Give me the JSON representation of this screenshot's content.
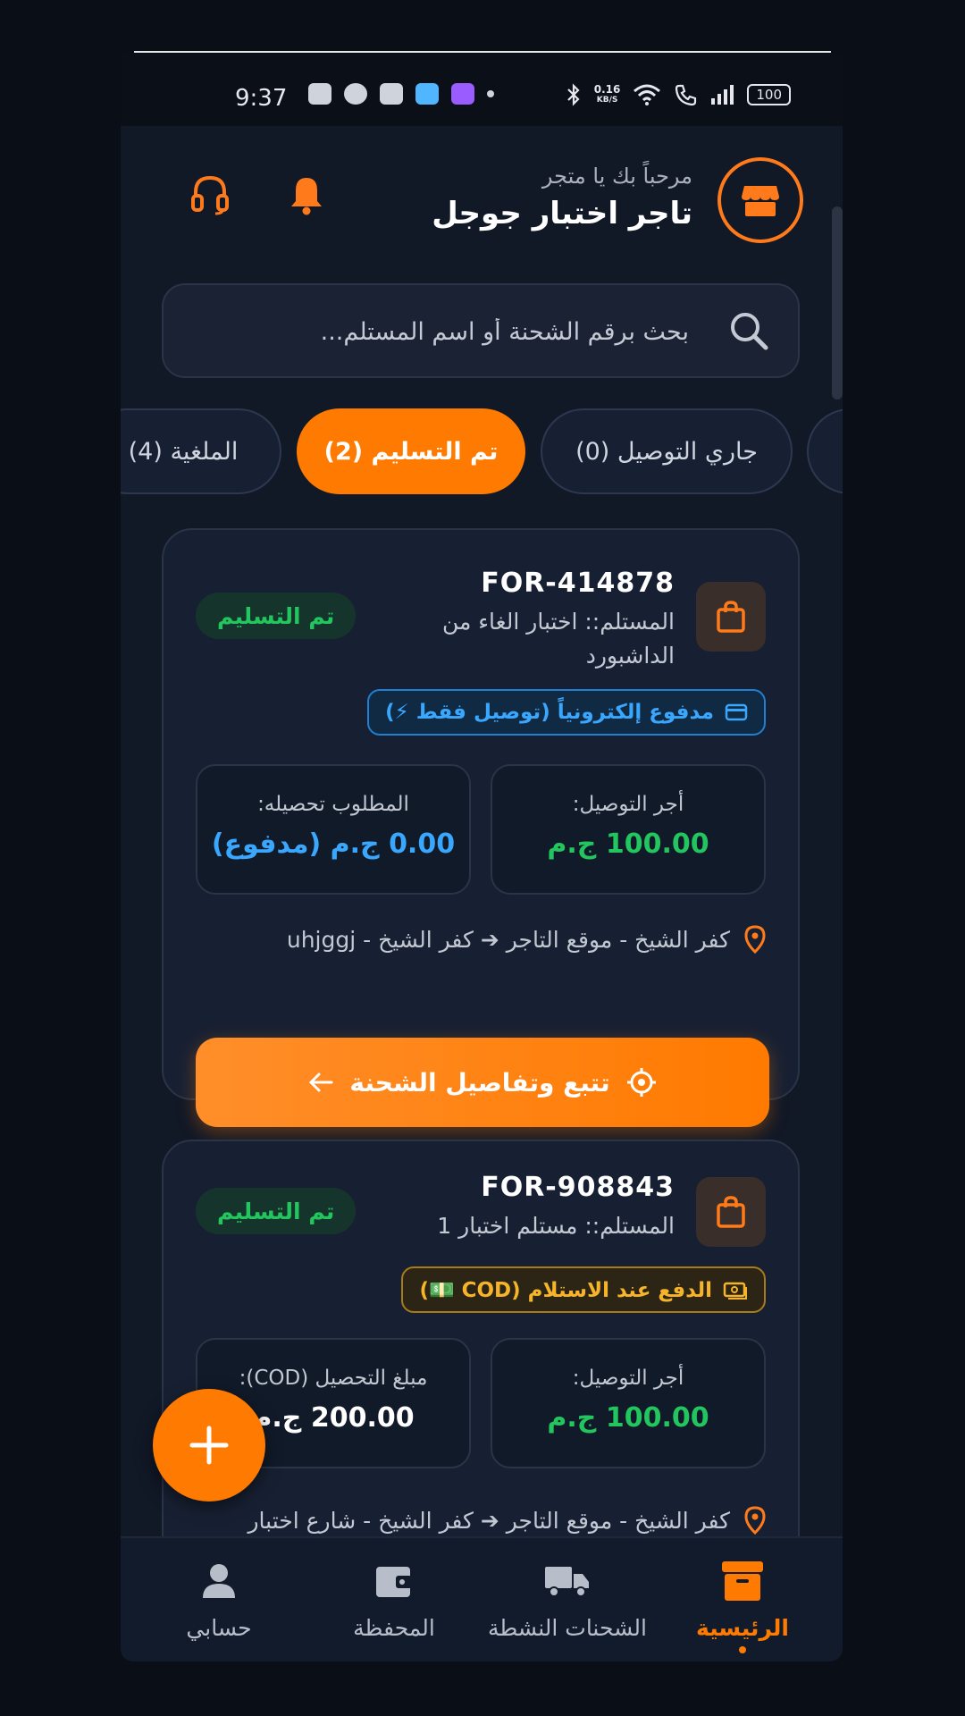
{
  "status_bar": {
    "time": "9:37",
    "net_speed": "0.16",
    "net_unit": "KB/S",
    "battery": "100"
  },
  "header": {
    "welcome": "مرحباً بك يا متجر",
    "store_name": "تاجر اختبار جوجل"
  },
  "search": {
    "placeholder": "بحث برقم الشحنة أو اسم المستلم..."
  },
  "tabs": [
    {
      "label": "جاري التوصيل (0)",
      "active": false
    },
    {
      "label": "تم التسليم (2)",
      "active": true
    },
    {
      "label": "الملغية (4)",
      "active": false
    }
  ],
  "orders": [
    {
      "id": "FOR-414878",
      "recipient": "المستلم:: اختبار الغاء من الداشبورد",
      "status": "تم التسليم",
      "payment": "مدفوع إلكترونياً (توصيل فقط ⚡)",
      "fee_label": "أجر التوصيل:",
      "fee_value": "100.00 ج.م",
      "collect_label": "المطلوب تحصيله:",
      "collect_value": "0.00 ج.م (مدفوع)",
      "route": "كفر الشيخ - موقع التاجر ➔ كفر الشيخ - uhjggj",
      "track_label": "تتبع وتفاصيل الشحنة"
    },
    {
      "id": "FOR-908843",
      "recipient": "المستلم:: مستلم اختبار 1",
      "status": "تم التسليم",
      "payment": "الدفع عند الاستلام (COD 💵)",
      "fee_label": "أجر التوصيل:",
      "fee_value": "100.00 ج.م",
      "collect_label": "مبلغ التحصيل (COD):",
      "collect_value": "200.00 ج.م",
      "route": "كفر الشيخ - موقع التاجر ➔ كفر الشيخ - شارع اختبار"
    }
  ],
  "bottom_nav": [
    {
      "label": "الرئيسية",
      "icon": "archive-box-icon",
      "active": true
    },
    {
      "label": "الشحنات النشطة",
      "icon": "truck-icon",
      "active": false
    },
    {
      "label": "المحفظة",
      "icon": "wallet-icon",
      "active": false
    },
    {
      "label": "حسابي",
      "icon": "user-icon",
      "active": false
    }
  ],
  "colors": {
    "accent": "#ff7a00",
    "success": "#22c55e",
    "info": "#3aa7ff",
    "background": "#111826"
  }
}
